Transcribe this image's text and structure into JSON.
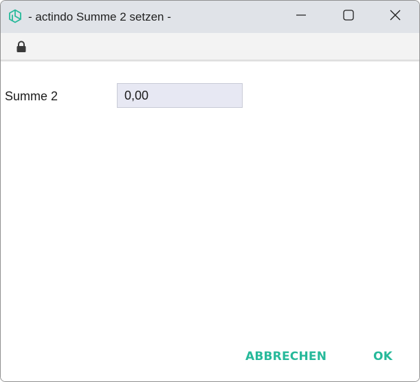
{
  "window": {
    "title": "- actindo Summe 2 setzen -",
    "icons": {
      "app": "actindo-logo-icon",
      "minimize": "minimize-icon",
      "maximize": "maximize-icon",
      "close": "close-icon",
      "lock": "lock-icon"
    }
  },
  "form": {
    "field_label": "Summe 2",
    "field_value": "0,00"
  },
  "actions": {
    "cancel_label": "ABBRECHEN",
    "ok_label": "OK"
  },
  "colors": {
    "accent": "#26b99a",
    "titlebar": "#e0e3e8",
    "input_background": "#e7e8f3"
  }
}
